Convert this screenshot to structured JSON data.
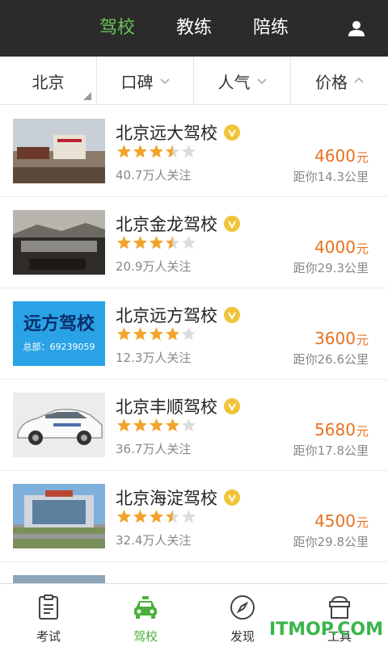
{
  "topbar": {
    "tabs": [
      {
        "label": "驾校",
        "active": true
      },
      {
        "label": "教练",
        "active": false
      },
      {
        "label": "陪练",
        "active": false
      }
    ],
    "user_icon": "user-icon",
    "active_color": "#69c35a"
  },
  "filters": [
    {
      "label": "北京",
      "indicator": "corner-triangle-icon"
    },
    {
      "label": "口碑",
      "indicator": "chevron-down-icon"
    },
    {
      "label": "人气",
      "indicator": "chevron-down-icon"
    },
    {
      "label": "价格",
      "indicator": "chevron-up-icon"
    }
  ],
  "schools": [
    {
      "name": "北京远大驾校",
      "rating": 3.5,
      "followers": "40.7万人关注",
      "price": "4600",
      "unit": "元",
      "distance": "距你14.3公里"
    },
    {
      "name": "北京金龙驾校",
      "rating": 3.5,
      "followers": "20.9万人关注",
      "price": "4000",
      "unit": "元",
      "distance": "距你29.3公里"
    },
    {
      "name": "北京远方驾校",
      "rating": 4,
      "followers": "12.3万人关注",
      "price": "3600",
      "unit": "元",
      "distance": "距你26.6公里",
      "thumb_text_1": "远方驾校",
      "thumb_text_2": "总部：69239059"
    },
    {
      "name": "北京丰顺驾校",
      "rating": 4,
      "followers": "36.7万人关注",
      "price": "5680",
      "unit": "元",
      "distance": "距你17.8公里"
    },
    {
      "name": "北京海淀驾校",
      "rating": 3.5,
      "followers": "32.4万人关注",
      "price": "4500",
      "unit": "元",
      "distance": "距你29.8公里"
    }
  ],
  "bottom_nav": [
    {
      "label": "考试",
      "icon": "exam-icon",
      "active": false
    },
    {
      "label": "驾校",
      "icon": "car-icon",
      "active": true
    },
    {
      "label": "发现",
      "icon": "compass-icon",
      "active": false
    },
    {
      "label": "工具",
      "icon": "tools-icon",
      "active": false
    }
  ],
  "watermark": "ITMOP.COM",
  "colors": {
    "price": "#e8701f",
    "star": "#f2a32c",
    "badge": "#f0c43a",
    "active_tab": "#4cae3c"
  }
}
